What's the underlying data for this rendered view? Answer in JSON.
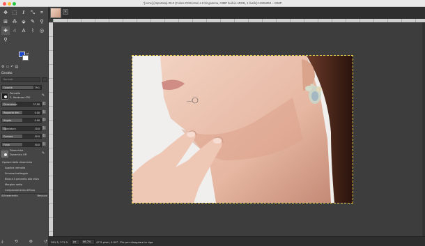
{
  "window": {
    "title": "*[Acne] (importata)-29.0 (Colore RGB interi a 8 bit gamma, GIMP built-in sRGB, 1 livello) 1280x853 – GIMP"
  },
  "toolbox": {
    "tools": [
      {
        "icon": "move-icon",
        "glyph": "✥"
      },
      {
        "icon": "rect-select-icon",
        "glyph": "⬚"
      },
      {
        "icon": "lasso-icon",
        "glyph": "ℓ"
      },
      {
        "icon": "align-icon",
        "glyph": "⤡"
      },
      {
        "icon": "crop-icon",
        "glyph": "⌗"
      },
      {
        "icon": "unified-transform-icon",
        "glyph": "⊞"
      },
      {
        "icon": "warp-icon",
        "glyph": "⁂"
      },
      {
        "icon": "fill-icon",
        "glyph": "⬙"
      },
      {
        "icon": "paintbrush-icon",
        "glyph": "✎"
      },
      {
        "icon": "eyedropper-icon",
        "glyph": "⚲"
      },
      {
        "icon": "heal-icon",
        "glyph": "✚"
      },
      {
        "icon": "smudge-icon",
        "glyph": "☝"
      },
      {
        "icon": "text-icon",
        "glyph": "A"
      },
      {
        "icon": "path-icon",
        "glyph": "⌇"
      },
      {
        "icon": "fg-select-icon",
        "glyph": "◎"
      },
      {
        "icon": "zoom-icon",
        "glyph": "⚲"
      }
    ],
    "selected_tool_index": 10,
    "fg_color": "#1c48c8",
    "bg_color": "#ffffff",
    "tool_title": "Cerotto",
    "mode_label": "Modalità",
    "mode_value": "Normale",
    "opacity": {
      "label": "Opacità",
      "value": "79.1"
    },
    "brush": {
      "label": "Pennello",
      "value": "2. Hardness 050"
    },
    "sliders": [
      {
        "label": "Dimensione",
        "value": "37.00",
        "level": 0.35
      },
      {
        "label": "Rapporto dim...",
        "value": "0.00",
        "level": 0.5
      },
      {
        "label": "Angolo",
        "value": "0.00",
        "level": 0.5
      },
      {
        "label": "Spaziatura",
        "value": "10.0",
        "level": 0.1
      },
      {
        "label": "Durezza",
        "value": "50.0",
        "level": 0.5
      },
      {
        "label": "Forza",
        "value": "50.0",
        "level": 0.5
      }
    ],
    "dynamics": {
      "label": "Dinamiche",
      "value": "Dynamics Off"
    },
    "options": [
      "Opzioni delle dinamiche",
      "Applica tremolio",
      "Smussa tratteggio",
      "Blocca il pennello alla vista",
      "Margine netto",
      "Campionamento diffuso"
    ],
    "alignment": {
      "label": "Allineamento",
      "value": "Nessuno"
    }
  },
  "statusbar": {
    "coords": "381.5, 271.5",
    "unit": "px",
    "zoom": "66.7%",
    "message": "47.5 pixel, 0.00°. Clic per disegnare la riga"
  }
}
